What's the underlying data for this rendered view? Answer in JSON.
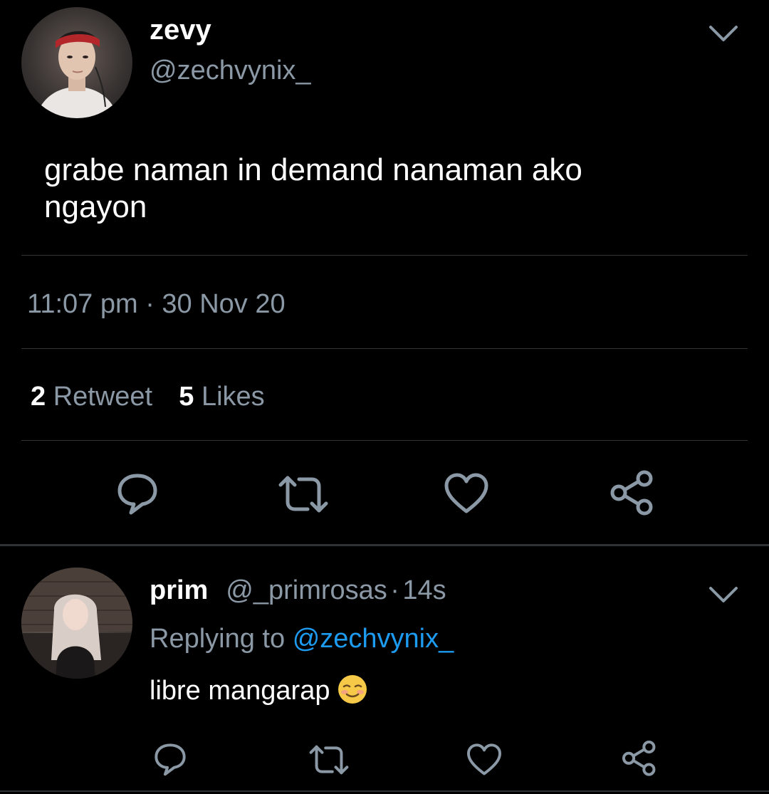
{
  "tweet": {
    "author_name": "zevy",
    "author_handle": "@zechvynix_",
    "avatar_icon": "profile-photo",
    "text": "grabe naman in demand nanaman ako ngayon",
    "time": "11:07 pm",
    "separator": "·",
    "date": "30 Nov 20",
    "retweet_count": "2",
    "retweet_label": "Retweet",
    "like_count": "5",
    "like_label": "Likes",
    "actions": [
      "reply-icon",
      "retweet-icon",
      "like-icon",
      "share-icon"
    ]
  },
  "reply": {
    "author_name": "prim",
    "author_handle": "@_primrosas",
    "separator": "·",
    "time_ago": "14s",
    "replying_to_label": "Replying to",
    "replying_to_handle": "@zechvynix_",
    "text": "libre mangarap",
    "emoji_icon": "smiling-face-emoji",
    "actions": [
      "reply-icon",
      "retweet-icon",
      "like-icon",
      "share-icon"
    ]
  },
  "colors": {
    "background": "#000000",
    "secondary_text": "#8b98a5",
    "link": "#1d9bf0",
    "divider": "#2f3336",
    "icon": "#8b98a5"
  }
}
